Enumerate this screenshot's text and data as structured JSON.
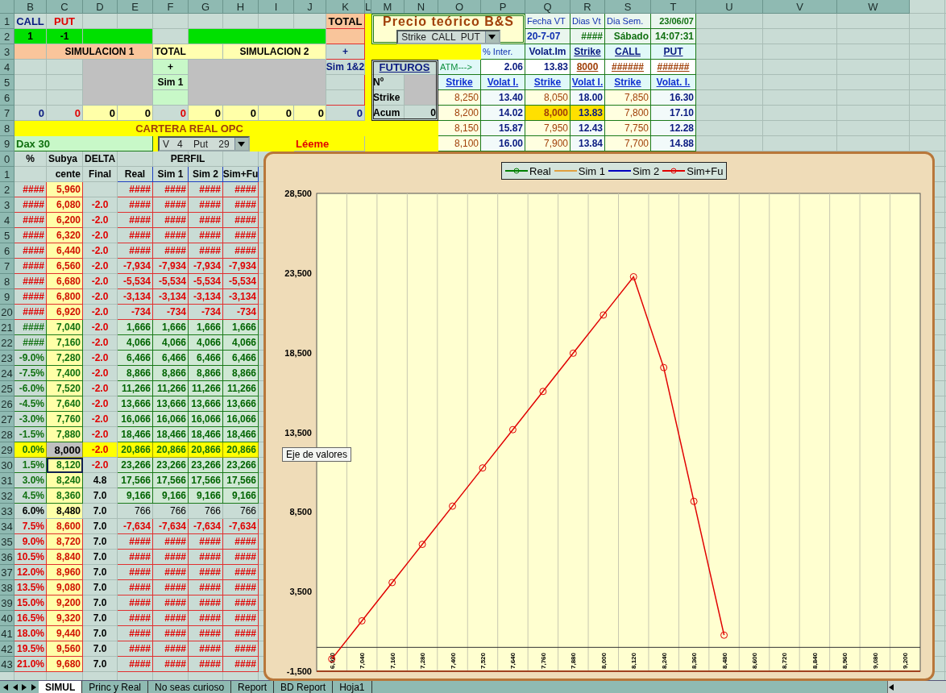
{
  "column_headers": [
    "B",
    "C",
    "D",
    "E",
    "F",
    "G",
    "H",
    "I",
    "J",
    "K",
    "L",
    "M",
    "N",
    "O",
    "P",
    "Q",
    "R",
    "S",
    "T",
    "U",
    "V",
    "W"
  ],
  "row_headers": [
    "1",
    "2",
    "3",
    "4",
    "5",
    "6",
    "7",
    "8",
    "9",
    "0",
    "1",
    "2",
    "3",
    "4",
    "5",
    "6",
    "7",
    "8",
    "9",
    "20",
    "21",
    "22",
    "23",
    "24",
    "25",
    "26",
    "27",
    "28",
    "29",
    "30",
    "31",
    "32",
    "33",
    "34",
    "35",
    "36",
    "37",
    "38",
    "39",
    "40",
    "41",
    "42",
    "43"
  ],
  "positions": {
    "call_label": "CALL",
    "put_label": "PUT",
    "total_label": "TOTAL",
    "call_qty": "1",
    "put_qty": "-1"
  },
  "simulation": {
    "sim1_title": "SIMULACION 1",
    "total_title": "TOTAL",
    "sim2_title": "SIMULACION 2",
    "total_plus": "+",
    "sim1_plus": "+",
    "sim1_label": "Sim 1",
    "sim12_label": "Sim 1&2"
  },
  "totals": [
    {
      "text": "0",
      "color": "#0a1a80"
    },
    {
      "text": "0",
      "color": "#e00000"
    },
    {
      "text": "0",
      "color": "#000000"
    },
    {
      "text": "0",
      "color": "#000000"
    },
    {
      "text": "0",
      "color": "#e00000"
    },
    {
      "text": "0",
      "color": "#000000"
    },
    {
      "text": "0",
      "color": "#000000"
    },
    {
      "text": "0",
      "color": "#000000"
    },
    {
      "text": "0",
      "color": "#000000"
    },
    {
      "text": "0",
      "color": "#0a1a80"
    }
  ],
  "portfolio": {
    "title": "CARTERA REAL OPC",
    "index_name": "Dax 30",
    "option_select": "V   4    Put    29",
    "readme_link": "Léeme"
  },
  "bs_panel": {
    "title": "Precio teórico B&S",
    "select_value": "Strike  CALL  PUT",
    "info": [
      {
        "label": "Fecha VT",
        "value": "20-7-07"
      },
      {
        "label": "Dias Vt",
        "value": "####"
      },
      {
        "label": "Dia Sem.",
        "value": "Sábado"
      },
      {
        "label": "23/06/07",
        "value": "14:07:31"
      }
    ]
  },
  "atm": {
    "headers": [
      "% Inter.",
      "Volat.Im",
      "Strike",
      "CALL",
      "PUT"
    ],
    "label": "ATM--->",
    "values": [
      "2.06",
      "13.83",
      "8000",
      "######",
      "######"
    ]
  },
  "futuros": {
    "title": "FUTUROS",
    "labels": [
      "Nº",
      "Strike",
      "Acum"
    ],
    "acum": "0"
  },
  "strikes": {
    "headers": [
      "Strike",
      "Volat I.",
      "Strike",
      "Volat I.",
      "Strike",
      "Volat. I."
    ],
    "rows": [
      {
        "cells": [
          "8,250",
          "13.40",
          "8,050",
          "18.00",
          "7,850",
          "16.30"
        ],
        "selected": false
      },
      {
        "cells": [
          "8,200",
          "14.02",
          "8,000",
          "13.83",
          "7,800",
          "17.10"
        ],
        "selected": true
      },
      {
        "cells": [
          "8,150",
          "15.87",
          "7,950",
          "12.43",
          "7,750",
          "12.28"
        ],
        "selected": false
      },
      {
        "cells": [
          "8,100",
          "16.00",
          "7,900",
          "13.84",
          "7,700",
          "14.88"
        ],
        "selected": false
      }
    ]
  },
  "profile_table": {
    "header_top": [
      "%",
      "Subya",
      "DELTA",
      "PERFIL"
    ],
    "header_bottom": [
      "cente",
      "Final",
      "Real",
      "Sim 1",
      "Sim 2",
      "Sim+Fu"
    ],
    "rows": [
      {
        "pct": "####",
        "under": "5,960",
        "values": [
          "####",
          "####",
          "####",
          "####"
        ],
        "kind": "loss",
        "selected": false
      },
      {
        "pct": "####",
        "under": "6,080",
        "delta": "-2.0",
        "delta_negative": true,
        "values": [
          "####",
          "####",
          "####",
          "####"
        ],
        "kind": "loss",
        "selected": false
      },
      {
        "pct": "####",
        "under": "6,200",
        "delta": "-2.0",
        "delta_negative": true,
        "values": [
          "####",
          "####",
          "####",
          "####"
        ],
        "kind": "loss",
        "selected": false
      },
      {
        "pct": "####",
        "under": "6,320",
        "delta": "-2.0",
        "delta_negative": true,
        "values": [
          "####",
          "####",
          "####",
          "####"
        ],
        "kind": "loss",
        "selected": false
      },
      {
        "pct": "####",
        "under": "6,440",
        "delta": "-2.0",
        "delta_negative": true,
        "values": [
          "####",
          "####",
          "####",
          "####"
        ],
        "kind": "loss",
        "selected": false
      },
      {
        "pct": "####",
        "under": "6,560",
        "delta": "-2.0",
        "delta_negative": true,
        "values": [
          "-7,934",
          "-7,934",
          "-7,934",
          "-7,934"
        ],
        "kind": "loss",
        "selected": false
      },
      {
        "pct": "####",
        "under": "6,680",
        "delta": "-2.0",
        "delta_negative": true,
        "values": [
          "-5,534",
          "-5,534",
          "-5,534",
          "-5,534"
        ],
        "kind": "loss",
        "selected": false
      },
      {
        "pct": "####",
        "under": "6,800",
        "delta": "-2.0",
        "delta_negative": true,
        "values": [
          "-3,134",
          "-3,134",
          "-3,134",
          "-3,134"
        ],
        "kind": "loss",
        "selected": false
      },
      {
        "pct": "####",
        "under": "6,920",
        "delta": "-2.0",
        "delta_negative": true,
        "values": [
          "-734",
          "-734",
          "-734",
          "-734"
        ],
        "kind": "loss",
        "selected": false
      },
      {
        "pct": "####",
        "under": "7,040",
        "delta": "-2.0",
        "delta_negative": true,
        "values": [
          "1,666",
          "1,666",
          "1,666",
          "1,666"
        ],
        "kind": "profit",
        "selected": false
      },
      {
        "pct": "####",
        "under": "7,160",
        "delta": "-2.0",
        "delta_negative": true,
        "values": [
          "4,066",
          "4,066",
          "4,066",
          "4,066"
        ],
        "kind": "profit",
        "selected": false
      },
      {
        "pct": "-9.0%",
        "under": "7,280",
        "delta": "-2.0",
        "delta_negative": true,
        "values": [
          "6,466",
          "6,466",
          "6,466",
          "6,466"
        ],
        "kind": "profit",
        "selected": false
      },
      {
        "pct": "-7.5%",
        "under": "7,400",
        "delta": "-2.0",
        "delta_negative": true,
        "values": [
          "8,866",
          "8,866",
          "8,866",
          "8,866"
        ],
        "kind": "profit",
        "selected": false
      },
      {
        "pct": "-6.0%",
        "under": "7,520",
        "delta": "-2.0",
        "delta_negative": true,
        "values": [
          "11,266",
          "11,266",
          "11,266",
          "11,266"
        ],
        "kind": "profit",
        "selected": false
      },
      {
        "pct": "-4.5%",
        "under": "7,640",
        "delta": "-2.0",
        "delta_negative": true,
        "values": [
          "13,666",
          "13,666",
          "13,666",
          "13,666"
        ],
        "kind": "profit",
        "selected": false
      },
      {
        "pct": "-3.0%",
        "under": "7,760",
        "delta": "-2.0",
        "delta_negative": true,
        "values": [
          "16,066",
          "16,066",
          "16,066",
          "16,066"
        ],
        "kind": "profit",
        "selected": false
      },
      {
        "pct": "-1.5%",
        "under": "7,880",
        "delta": "-2.0",
        "delta_negative": true,
        "values": [
          "18,466",
          "18,466",
          "18,466",
          "18,466"
        ],
        "kind": "profit",
        "selected": false
      },
      {
        "pct": "0.0%",
        "under": "8,000",
        "delta": "-2.0",
        "delta_negative": true,
        "values": [
          "20,866",
          "20,866",
          "20,866",
          "20,866"
        ],
        "kind": "atm",
        "selected": false
      },
      {
        "pct": "1.5%",
        "under": "8,120",
        "delta": "-2.0",
        "delta_negative": true,
        "values": [
          "23,266",
          "23,266",
          "23,266",
          "23,266"
        ],
        "kind": "profit",
        "selected": true
      },
      {
        "pct": "3.0%",
        "under": "8,240",
        "delta": "4.8",
        "delta_negative": false,
        "values": [
          "17,566",
          "17,566",
          "17,566",
          "17,566"
        ],
        "kind": "profit",
        "selected": false
      },
      {
        "pct": "4.5%",
        "under": "8,360",
        "delta": "7.0",
        "delta_negative": false,
        "values": [
          "9,166",
          "9,166",
          "9,166",
          "9,166"
        ],
        "kind": "profit",
        "selected": false
      },
      {
        "pct": "6.0%",
        "under": "8,480",
        "delta": "7.0",
        "delta_negative": false,
        "values": [
          "766",
          "766",
          "766",
          "766"
        ],
        "kind": "even",
        "selected": false
      },
      {
        "pct": "7.5%",
        "under": "8,600",
        "delta": "7.0",
        "delta_negative": false,
        "values": [
          "-7,634",
          "-7,634",
          "-7,634",
          "-7,634"
        ],
        "kind": "loss",
        "selected": false
      },
      {
        "pct": "9.0%",
        "under": "8,720",
        "delta": "7.0",
        "delta_negative": false,
        "values": [
          "####",
          "####",
          "####",
          "####"
        ],
        "kind": "loss",
        "selected": false
      },
      {
        "pct": "10.5%",
        "under": "8,840",
        "delta": "7.0",
        "delta_negative": false,
        "values": [
          "####",
          "####",
          "####",
          "####"
        ],
        "kind": "loss",
        "selected": false
      },
      {
        "pct": "12.0%",
        "under": "8,960",
        "delta": "7.0",
        "delta_negative": false,
        "values": [
          "####",
          "####",
          "####",
          "####"
        ],
        "kind": "loss",
        "selected": false
      },
      {
        "pct": "13.5%",
        "under": "9,080",
        "delta": "7.0",
        "delta_negative": false,
        "values": [
          "####",
          "####",
          "####",
          "####"
        ],
        "kind": "loss",
        "selected": false
      },
      {
        "pct": "15.0%",
        "under": "9,200",
        "delta": "7.0",
        "delta_negative": false,
        "values": [
          "####",
          "####",
          "####",
          "####"
        ],
        "kind": "loss",
        "selected": false
      },
      {
        "pct": "16.5%",
        "under": "9,320",
        "delta": "7.0",
        "delta_negative": false,
        "values": [
          "####",
          "####",
          "####",
          "####"
        ],
        "kind": "loss",
        "selected": false
      },
      {
        "pct": "18.0%",
        "under": "9,440",
        "delta": "7.0",
        "delta_negative": false,
        "values": [
          "####",
          "####",
          "####",
          "####"
        ],
        "kind": "loss",
        "selected": false
      },
      {
        "pct": "19.5%",
        "under": "9,560",
        "delta": "7.0",
        "delta_negative": false,
        "values": [
          "####",
          "####",
          "####",
          "####"
        ],
        "kind": "loss",
        "selected": false
      },
      {
        "pct": "21.0%",
        "under": "9,680",
        "delta": "7.0",
        "delta_negative": false,
        "values": [
          "####",
          "####",
          "####",
          "####"
        ],
        "kind": "loss",
        "selected": false
      }
    ]
  },
  "chart": {
    "tooltip": "Eje de valores",
    "legend": [
      {
        "label": "Real",
        "color": "#008000",
        "marker": true
      },
      {
        "label": "Sim 1",
        "color": "#e0a040",
        "marker": false
      },
      {
        "label": "Sim 2",
        "color": "#0000c0",
        "marker": false
      }
    ],
    "chart_data": {
      "type": "line",
      "categories": [
        "6,920",
        "7,040",
        "7,160",
        "7,280",
        "7,400",
        "7,520",
        "7,640",
        "7,760",
        "7,880",
        "8,000",
        "8,120",
        "8,240",
        "8,360",
        "8,480",
        "8,600",
        "8,720",
        "8,840",
        "8,960",
        "9,080",
        "9,200"
      ],
      "ylim": [
        -1500,
        28500
      ],
      "yticks": [
        {
          "value": -1500,
          "label": "-1,500"
        },
        {
          "value": 3500,
          "label": "3,500"
        },
        {
          "value": 8500,
          "label": "8,500"
        },
        {
          "value": 13500,
          "label": "13,500"
        },
        {
          "value": 18500,
          "label": "18,500"
        },
        {
          "value": 23500,
          "label": "23,500"
        },
        {
          "value": 28500,
          "label": "28,500"
        }
      ],
      "series": [
        {
          "name": "Sim+Fu",
          "color": "#e00000",
          "marker": true,
          "values": [
            -734,
            1666,
            4066,
            6466,
            8866,
            11266,
            13666,
            16066,
            18466,
            20866,
            23266,
            17566,
            9166,
            766,
            null,
            null,
            null,
            null,
            null,
            null
          ]
        }
      ]
    }
  },
  "sheet_tabs": [
    {
      "label": "SIMUL",
      "selected": true
    },
    {
      "label": "Princ y Real",
      "selected": false
    },
    {
      "label": "No seas curioso",
      "selected": false
    },
    {
      "label": "Report",
      "selected": false
    },
    {
      "label": "BD Report",
      "selected": false
    },
    {
      "label": "Hoja1",
      "selected": false
    }
  ]
}
